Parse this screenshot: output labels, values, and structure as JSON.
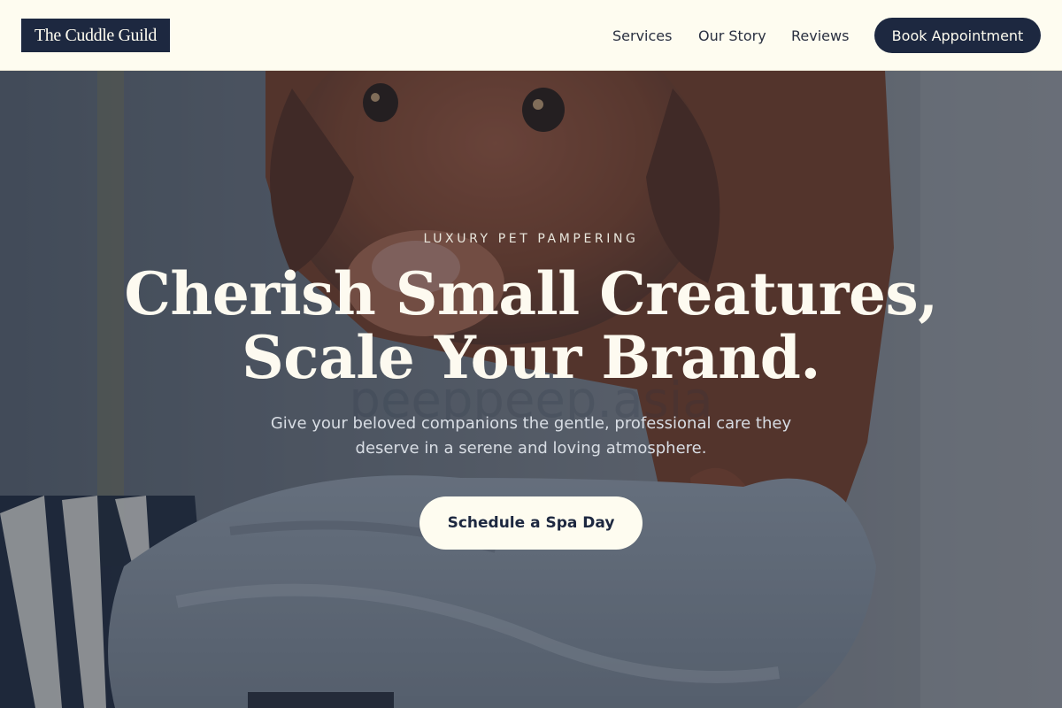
{
  "header": {
    "logo_text": "The Cuddle Guild",
    "nav": {
      "services": "Services",
      "our_story": "Our Story",
      "reviews": "Reviews"
    },
    "book_button": "Book Appointment"
  },
  "hero": {
    "eyebrow": "LUXURY PET PAMPERING",
    "headline_line1": "Cherish Small Creatures,",
    "headline_line2": "Scale Your Brand.",
    "subtext": "Give your beloved companions the gentle, professional care they deserve in a serene and loving atmosphere.",
    "cta_label": "Schedule a Spa Day",
    "watermark": "peeppeep.asia",
    "image_subject": "brown dog with grey towel"
  },
  "colors": {
    "navy": "#1d2840",
    "cream": "#fefcf0",
    "overlay": "#1c263a"
  }
}
